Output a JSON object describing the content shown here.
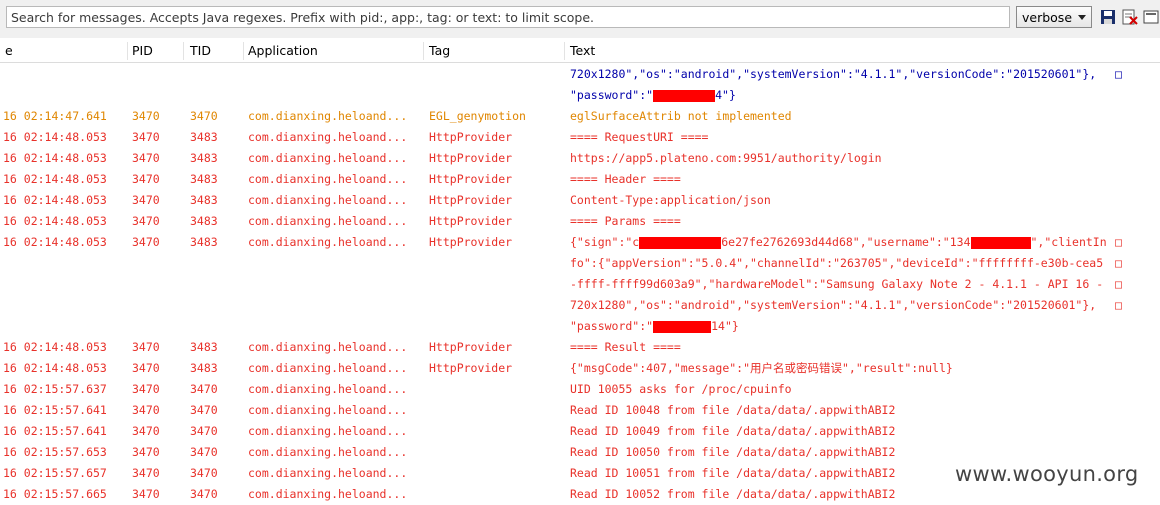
{
  "toolbar": {
    "search_placeholder": "Search for messages. Accepts Java regexes. Prefix with pid:, app:, tag: or text: to limit scope.",
    "level_value": "verbose"
  },
  "columns": {
    "time": "e",
    "pid": "PID",
    "tid": "TID",
    "app": "Application",
    "tag": "Tag",
    "text": "Text"
  },
  "wrap_mark": "□",
  "rows": [
    {
      "time": "",
      "pid": "",
      "tid": "",
      "app": "",
      "tag": "",
      "text": " 720x1280\",\"os\":\"android\",\"systemVersion\":\"4.1.1\",\"versionCode\":\"201520601\"}, ",
      "wrap": true,
      "level": "blue"
    },
    {
      "time": "",
      "pid": "",
      "tid": "",
      "app": "",
      "tag": "",
      "text_a": "\"password\":\"",
      "text_b": "4\"}",
      "level": "blue"
    },
    {
      "time": "16 02:14:47.641",
      "pid": "3470",
      "tid": "3470",
      "app": "com.dianxing.heloand...",
      "tag": "EGL_genymotion",
      "text": "eglSurfaceAttrib not implemented",
      "level": "orange"
    },
    {
      "time": "16 02:14:48.053",
      "pid": "3470",
      "tid": "3483",
      "app": "com.dianxing.heloand...",
      "tag": "HttpProvider",
      "text": "==== RequestURI ====",
      "level": "red"
    },
    {
      "time": "16 02:14:48.053",
      "pid": "3470",
      "tid": "3483",
      "app": "com.dianxing.heloand...",
      "tag": "HttpProvider",
      "text": "https://app5.plateno.com:9951/authority/login",
      "level": "red"
    },
    {
      "time": "16 02:14:48.053",
      "pid": "3470",
      "tid": "3483",
      "app": "com.dianxing.heloand...",
      "tag": "HttpProvider",
      "text": "==== Header ====",
      "level": "red"
    },
    {
      "time": "16 02:14:48.053",
      "pid": "3470",
      "tid": "3483",
      "app": "com.dianxing.heloand...",
      "tag": "HttpProvider",
      "text": "Content-Type:application/json",
      "level": "red"
    },
    {
      "time": "16 02:14:48.053",
      "pid": "3470",
      "tid": "3483",
      "app": "com.dianxing.heloand...",
      "tag": "HttpProvider",
      "text": "==== Params ====",
      "level": "red"
    },
    {
      "time": "16 02:14:48.053",
      "pid": "3470",
      "tid": "3483",
      "app": "com.dianxing.heloand...",
      "tag": "HttpProvider",
      "text_a": "{\"sign\":\"c",
      "text_b": "6e27fe2762693d44d68\",\"username\":\"134",
      "text_c": "\",\"clientIn ",
      "wrap": true,
      "level": "red",
      "params": true
    },
    {
      "time": "",
      "pid": "",
      "tid": "",
      "app": "",
      "tag": "",
      "text": "fo\":{\"appVersion\":\"5.0.4\",\"channelId\":\"263705\",\"deviceId\":\"ffffffff-e30b-cea5 ",
      "wrap": true,
      "level": "red"
    },
    {
      "time": "",
      "pid": "",
      "tid": "",
      "app": "",
      "tag": "",
      "text": "-ffff-ffff99d603a9\",\"hardwareModel\":\"Samsung Galaxy Note 2 - 4.1.1 - API 16 - ",
      "wrap": true,
      "level": "red"
    },
    {
      "time": "",
      "pid": "",
      "tid": "",
      "app": "",
      "tag": "",
      "text": " 720x1280\",\"os\":\"android\",\"systemVersion\":\"4.1.1\",\"versionCode\":\"201520601\"}, ",
      "wrap": true,
      "level": "red"
    },
    {
      "time": "",
      "pid": "",
      "tid": "",
      "app": "",
      "tag": "",
      "text_a": "\"password\":\"",
      "text_b": "14\"}",
      "level": "red",
      "pw": true
    },
    {
      "time": "16 02:14:48.053",
      "pid": "3470",
      "tid": "3483",
      "app": "com.dianxing.heloand...",
      "tag": "HttpProvider",
      "text": "==== Result ====",
      "level": "red"
    },
    {
      "time": "16 02:14:48.053",
      "pid": "3470",
      "tid": "3483",
      "app": "com.dianxing.heloand...",
      "tag": "HttpProvider",
      "text": "{\"msgCode\":407,\"message\":\"用户名或密码错误\",\"result\":null}",
      "level": "red"
    },
    {
      "time": "16 02:15:57.637",
      "pid": "3470",
      "tid": "3470",
      "app": "com.dianxing.heloand...",
      "tag": "",
      "text": "UID 10055 asks for /proc/cpuinfo",
      "level": "red"
    },
    {
      "time": "16 02:15:57.641",
      "pid": "3470",
      "tid": "3470",
      "app": "com.dianxing.heloand...",
      "tag": "",
      "text": "Read ID 10048 from file /data/data/.appwithABI2",
      "level": "red"
    },
    {
      "time": "16 02:15:57.641",
      "pid": "3470",
      "tid": "3470",
      "app": "com.dianxing.heloand...",
      "tag": "",
      "text": "Read ID 10049 from file /data/data/.appwithABI2",
      "level": "red"
    },
    {
      "time": "16 02:15:57.653",
      "pid": "3470",
      "tid": "3470",
      "app": "com.dianxing.heloand...",
      "tag": "",
      "text": "Read ID 10050 from file /data/data/.appwithABI2",
      "level": "red"
    },
    {
      "time": "16 02:15:57.657",
      "pid": "3470",
      "tid": "3470",
      "app": "com.dianxing.heloand...",
      "tag": "",
      "text": "Read ID 10051 from file /data/data/.appwithABI2",
      "level": "red"
    },
    {
      "time": "16 02:15:57.665",
      "pid": "3470",
      "tid": "3470",
      "app": "com.dianxing.heloand...",
      "tag": "",
      "text": "Read ID 10052 from file /data/data/.appwithABI2",
      "level": "red"
    }
  ],
  "watermark": "www.wooyun.org",
  "colors": {
    "warn": "#e08600",
    "error": "#e8312a",
    "debug": "#0000aa"
  }
}
